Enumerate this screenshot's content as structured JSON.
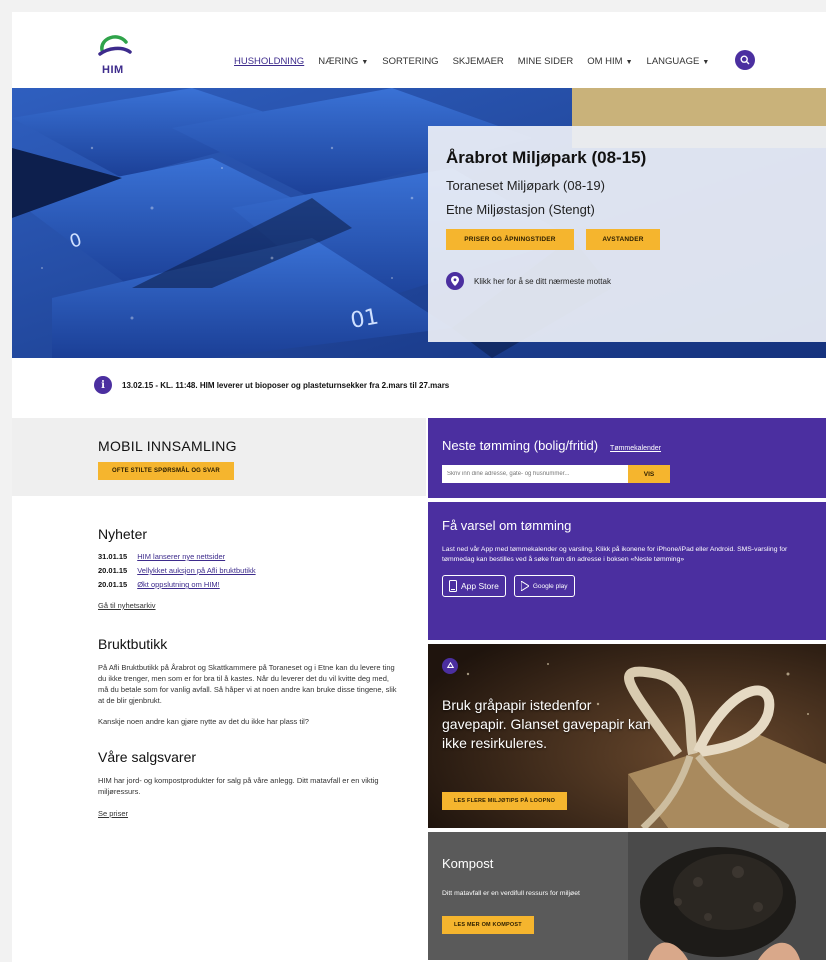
{
  "header": {
    "logo_text": "HIM",
    "nav": [
      {
        "label": "HUSHOLDNING",
        "active": true,
        "dropdown": false
      },
      {
        "label": "NÆRING",
        "active": false,
        "dropdown": true
      },
      {
        "label": "SORTERING",
        "active": false,
        "dropdown": false
      },
      {
        "label": "SKJEMAER",
        "active": false,
        "dropdown": false
      },
      {
        "label": "MINE SIDER",
        "active": false,
        "dropdown": false
      },
      {
        "label": "OM HIM",
        "active": false,
        "dropdown": true
      },
      {
        "label": "LANGUAGE",
        "active": false,
        "dropdown": true
      }
    ]
  },
  "hero": {
    "facility_1": "Årabrot Miljøpark (08-15)",
    "facility_2": "Toraneset Miljøpark (08-19)",
    "facility_3": "Etne Miljøstasjon (Stengt)",
    "btn_prices": "PRISER OG ÅPNINGSTIDER",
    "btn_distance": "AVSTANDER",
    "location_text": "Klikk her for å se ditt nærmeste mottak"
  },
  "notice": {
    "text": "13.02.15 - KL. 11:48. HIM leverer ut bioposer og plasteturnsekker fra 2.mars til 27.mars"
  },
  "mobil": {
    "title": "MOBIL INNSAMLING",
    "button": "OFTE STILTE SPØRSMÅL OG SVAR"
  },
  "news": {
    "title": "Nyheter",
    "items": [
      {
        "date": "31.01.15",
        "text": "HIM lanserer nye nettsider"
      },
      {
        "date": "20.01.15",
        "text": "Vellykket auksjon på Afli bruktbutikk"
      },
      {
        "date": "20.01.15",
        "text": "Økt oppslutning om HIM!"
      }
    ],
    "more_link": "Gå til nyhetsarkiv"
  },
  "bruktbutikk": {
    "title": "Bruktbutikk",
    "para_1": "På Afli Bruktbutikk på Årabrot og Skattkammere på Toraneset og i Etne kan du levere ting du ikke trenger, men som er for bra til å kastes. Når du leverer det du vil kvitte deg med, må du betale som for vanlig avfall. Så håper vi at noen andre kan bruke disse tingene, slik at de blir gjenbrukt.",
    "para_2": "Kanskje noen andre kan gjøre nytte av det du ikke har plass til?"
  },
  "salgsvarer": {
    "title": "Våre salgsvarer",
    "para": "HIM har jord- og kompostprodukter for salg på våre anlegg. Ditt matavfall er en viktig miljøressurs.",
    "link": "Se priser"
  },
  "tomming": {
    "title": "Neste tømming (bolig/fritid)",
    "calendar_link": "Tømmekalender",
    "input_placeholder": "Skriv inn dine adresse, gate- og husnummer...",
    "button": "VIS"
  },
  "varsel": {
    "title": "Få varsel om tømming",
    "text": "Last ned vår App med tømmekalender og varsling. Klikk på ikonene for iPhone/iPad eller Android. SMS-varsling for tømmedag kan bestilles ved å søke fram din adresse i boksen «Neste tømming»",
    "app_store": "App Store",
    "google_play": "Google play"
  },
  "gave": {
    "text": "Bruk gråpapir istedenfor gavepapir. Glanset gavepapir kan ikke resirkuleres.",
    "button": "LES FLERE MILJØTIPS PÅ LOOPNO"
  },
  "kompost": {
    "title": "Kompost",
    "text": "Ditt matavfall er en verdifull ressurs for miljøet",
    "button": "LES MER OM KOMPOST"
  },
  "colors": {
    "brand_purple": "#4b2fa0",
    "accent_yellow": "#f5b52e"
  }
}
